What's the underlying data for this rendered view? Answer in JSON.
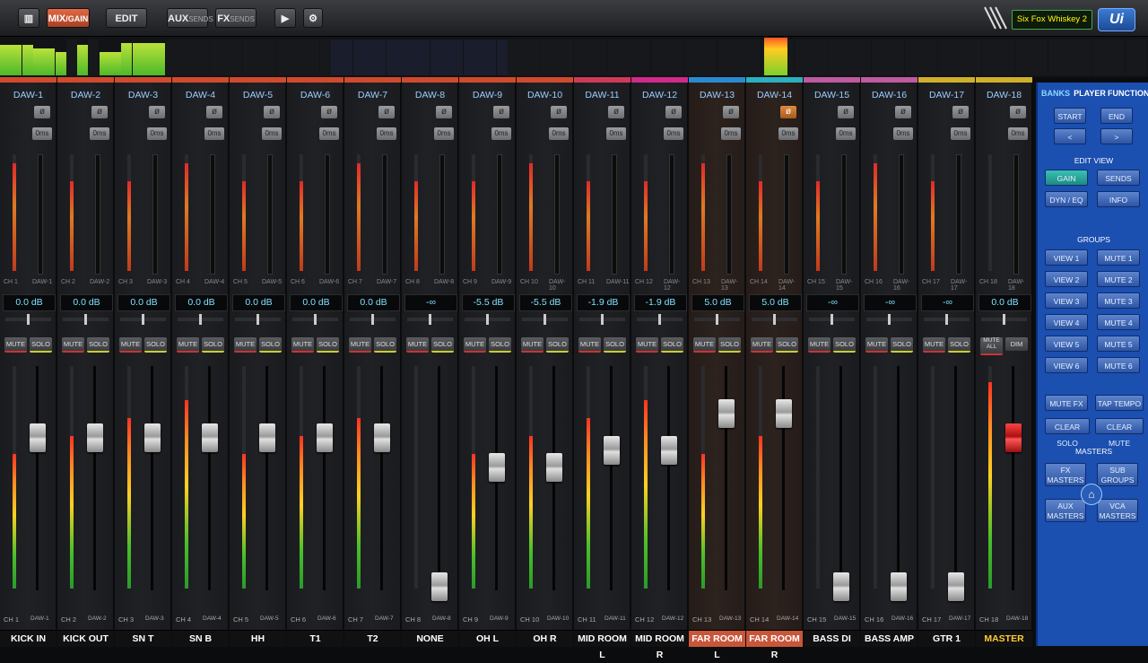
{
  "toolbar": {
    "mix_label": "MIX",
    "gain_label": "/GAIN",
    "edit_label": "EDIT",
    "aux_label": "AUX",
    "aux_sub": "SENDS",
    "fx_label": "FX",
    "fx_sub": "SENDS",
    "play_icon": "play-icon",
    "settings_icon": "gear-icon",
    "snapshot": "Six Fox Whiskey 2",
    "logo": "Ui"
  },
  "channels": [
    {
      "daw": "DAW-1",
      "ch": "CH 1",
      "gain_db": "0.0 dB",
      "name": "KICK IN",
      "phase_on": false,
      "fader": 0.72
    },
    {
      "daw": "DAW-2",
      "ch": "CH 2",
      "gain_db": "0.0 dB",
      "name": "KICK OUT",
      "phase_on": false,
      "fader": 0.72
    },
    {
      "daw": "DAW-3",
      "ch": "CH 3",
      "gain_db": "0.0 dB",
      "name": "SN T",
      "phase_on": false,
      "fader": 0.72
    },
    {
      "daw": "DAW-4",
      "ch": "CH 4",
      "gain_db": "0.0 dB",
      "name": "SN B",
      "phase_on": false,
      "fader": 0.72
    },
    {
      "daw": "DAW-5",
      "ch": "CH 5",
      "gain_db": "0.0 dB",
      "name": "HH",
      "phase_on": false,
      "fader": 0.72
    },
    {
      "daw": "DAW-6",
      "ch": "CH 6",
      "gain_db": "0.0 dB",
      "name": "T1",
      "phase_on": false,
      "fader": 0.72
    },
    {
      "daw": "DAW-7",
      "ch": "CH 7",
      "gain_db": "0.0 dB",
      "name": "T2",
      "phase_on": false,
      "fader": 0.72
    },
    {
      "daw": "DAW-8",
      "ch": "CH 8",
      "gain_db": "-∞",
      "name": "NONE",
      "phase_on": false,
      "fader": 0.0
    },
    {
      "daw": "DAW-9",
      "ch": "CH 9",
      "gain_db": "-5.5 dB",
      "name": "OH L",
      "phase_on": false,
      "fader": 0.58
    },
    {
      "daw": "DAW-10",
      "ch": "CH 10",
      "gain_db": "-5.5 dB",
      "name": "OH R",
      "phase_on": false,
      "fader": 0.58
    },
    {
      "daw": "DAW-11",
      "ch": "CH 11",
      "gain_db": "-1.9 dB",
      "name": "MID ROOM L",
      "phase_on": false,
      "fader": 0.66
    },
    {
      "daw": "DAW-12",
      "ch": "CH 12",
      "gain_db": "-1.9 dB",
      "name": "MID ROOM R",
      "phase_on": false,
      "fader": 0.66
    },
    {
      "daw": "DAW-13",
      "ch": "CH 13",
      "gain_db": "5.0 dB",
      "name": "FAR ROOM L",
      "phase_on": false,
      "fader": 0.84,
      "selected": true
    },
    {
      "daw": "DAW-14",
      "ch": "CH 14",
      "gain_db": "5.0 dB",
      "name": "FAR ROOM R",
      "phase_on": true,
      "fader": 0.84,
      "selected": true
    },
    {
      "daw": "DAW-15",
      "ch": "CH 15",
      "gain_db": "-∞",
      "name": "BASS DI",
      "phase_on": false,
      "fader": 0.0
    },
    {
      "daw": "DAW-16",
      "ch": "CH 16",
      "gain_db": "-∞",
      "name": "BASS AMP",
      "phase_on": false,
      "fader": 0.0
    },
    {
      "daw": "DAW-17",
      "ch": "CH 17",
      "gain_db": "-∞",
      "name": "GTR 1",
      "phase_on": false,
      "fader": 0.0
    },
    {
      "daw": "DAW-18",
      "ch": "CH 18",
      "gain_db": "0.0 dB",
      "name": "MASTER",
      "phase_on": false,
      "fader": 0.72,
      "master": true
    }
  ],
  "strip_text": {
    "phase_symbol": "ø",
    "delay": "0ms",
    "mute": "MUTE",
    "solo": "SOLO",
    "mute_all": "MUTE ALL",
    "dim": "DIM"
  },
  "panel": {
    "tabs": [
      "BANKS",
      "PLAYER",
      "FUNCTIONS"
    ],
    "start": "START",
    "end": "END",
    "prev": "<",
    "next": ">",
    "edit_view_title": "EDIT VIEW",
    "gain": "GAIN",
    "sends": "SENDS",
    "dyn_eq": "DYN / EQ",
    "info": "INFO",
    "groups_title": "GROUPS",
    "views": [
      "VIEW 1",
      "VIEW 2",
      "VIEW 3",
      "VIEW 4",
      "VIEW 5",
      "VIEW 6"
    ],
    "mutes": [
      "MUTE 1",
      "MUTE 2",
      "MUTE 3",
      "MUTE 4",
      "MUTE 5",
      "MUTE 6"
    ],
    "mute_fx": "MUTE FX",
    "tap_tempo": "TAP TEMPO",
    "clear_solo": "CLEAR SOLO",
    "clear_mute": "CLEAR MUTE",
    "masters_title": "MASTERS",
    "fx_masters": "FX MASTERS",
    "sub_groups": "SUB GROUPS",
    "aux_masters": "AUX MASTERS",
    "vca_masters": "VCA MASTERS",
    "home_icon": "home-icon"
  },
  "colors": {
    "accent": "#c8563a",
    "panel_blue": "#1b4fb0",
    "db_text": "#7fe0ff",
    "master_name": "#ffcc33"
  }
}
